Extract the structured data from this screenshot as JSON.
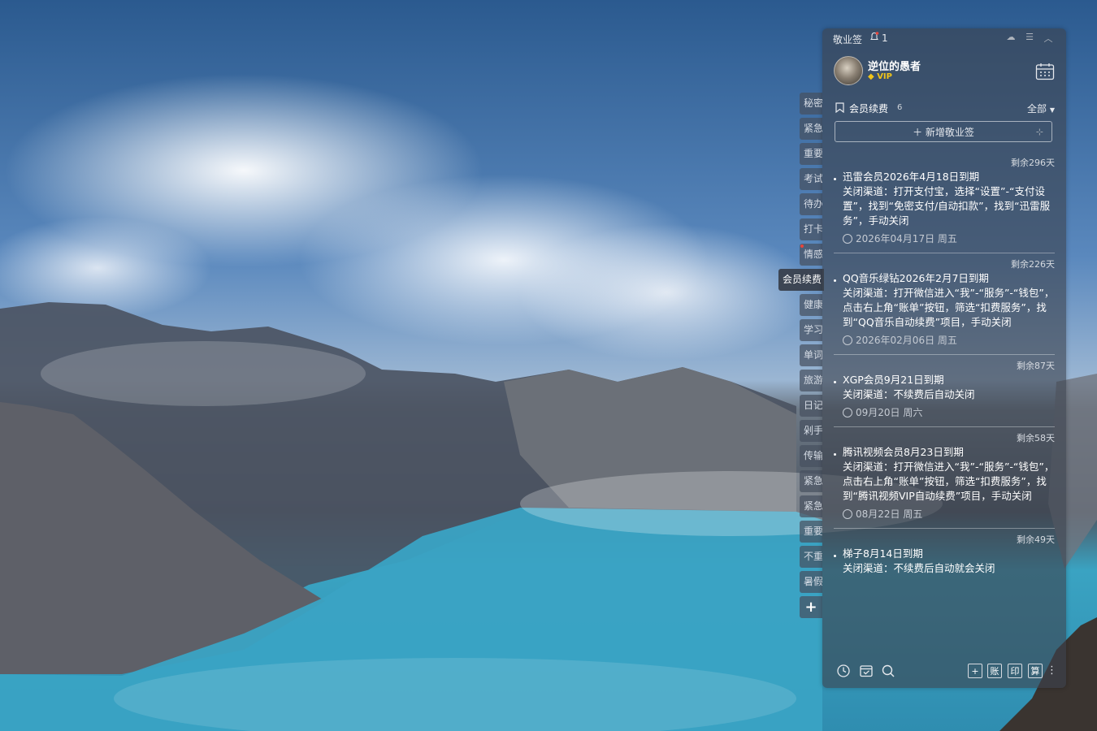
{
  "app": {
    "name": "敬业签",
    "notification_count": "1"
  },
  "user": {
    "name": "逆位的愚者",
    "badge": "VIP"
  },
  "side_tabs": [
    {
      "label": "秘密"
    },
    {
      "label": "紧急"
    },
    {
      "label": "重要"
    },
    {
      "label": "考试"
    },
    {
      "label": "待办"
    },
    {
      "label": "打卡"
    },
    {
      "label": "情感",
      "dot": true
    },
    {
      "label": "会员续费",
      "active": true
    },
    {
      "label": "健康"
    },
    {
      "label": "学习"
    },
    {
      "label": "单词"
    },
    {
      "label": "旅游"
    },
    {
      "label": "日记"
    },
    {
      "label": "剁手"
    },
    {
      "label": "传输"
    },
    {
      "label": "紧急"
    },
    {
      "label": "紧急"
    },
    {
      "label": "重要"
    },
    {
      "label": "不重"
    },
    {
      "label": "暑假"
    }
  ],
  "add_tab": "+",
  "category": {
    "name": "会员续费",
    "count": "6",
    "filter": "全部"
  },
  "new_note_button": "＋ 新增敬业签",
  "notes": [
    {
      "remaining": "剩余296天",
      "title": "迅雷会员2026年4月18日到期",
      "body": "关闭渠道：打开支付宝，选择“设置”-“支付设置”，找到“免密支付/自动扣款”，找到“迅雷服务”，手动关闭",
      "date": "2026年04月17日 周五"
    },
    {
      "remaining": "剩余226天",
      "title": "QQ音乐绿钻2026年2月7日到期",
      "body": "关闭渠道：打开微信进入“我”-“服务”-“钱包”，点击右上角“账单”按钮，筛选“扣费服务”，找到“QQ音乐自动续费”项目，手动关闭",
      "date": "2026年02月06日 周五"
    },
    {
      "remaining": "剩余87天",
      "title": "XGP会员9月21日到期",
      "body": "关闭渠道：不续费后自动关闭",
      "date": "09月20日 周六"
    },
    {
      "remaining": "剩余58天",
      "title": "腾讯视频会员8月23日到期",
      "body": "关闭渠道：打开微信进入“我”-“服务”-“钱包”，点击右上角“账单”按钮，筛选“扣费服务”，找到“腾讯视频VIP自动续费”项目，手动关闭",
      "date": "08月22日 周五"
    },
    {
      "remaining": "剩余49天",
      "title": "梯子8月14日到期",
      "body": "关闭渠道：不续费后自动就会关闭",
      "date": ""
    }
  ],
  "toolbar": {
    "ledger": "账",
    "print": "印",
    "calc": "算",
    "add": "+"
  }
}
